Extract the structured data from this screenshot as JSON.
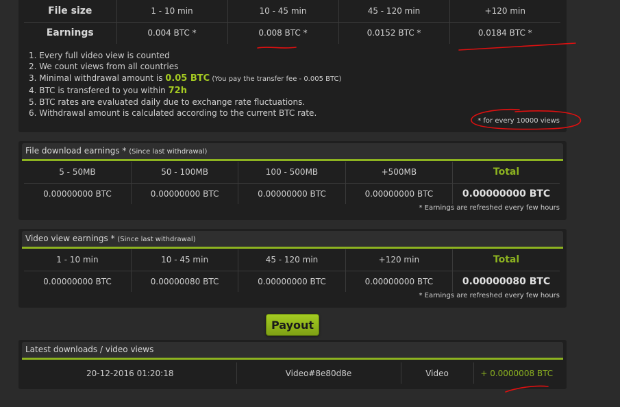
{
  "video_rates": {
    "file_size_label": "File size",
    "earnings_label": "Earnings",
    "durations": [
      "1 - 10 min",
      "10 - 45 min",
      "45 - 120 min",
      "+120 min"
    ],
    "rates": [
      "0.004 BTC *",
      "0.008 BTC *",
      "0.0152 BTC *",
      "0.0184 BTC *"
    ],
    "notes": {
      "n1": "1. Every full video view is counted",
      "n2": "2. We count views from all countries",
      "n3_prefix": "3. Minimal withdrawal amount is ",
      "n3_amount": "0.05 BTC",
      "n3_fee": " (You pay the transfer fee - 0.005 BTC)",
      "n4_prefix": "4. BTC is transfered to you within ",
      "n4_time": "72h",
      "n5": "5. BTC rates are evaluated daily due to exchange rate fluctuations.",
      "n6": "6. Withdrawal amount is calculated according to the current BTC rate."
    },
    "footnote": "* for every 10000 views"
  },
  "file_earnings": {
    "title": "File download earnings * ",
    "since": "(Since last withdrawal)",
    "columns": [
      "5 - 50MB",
      "50 - 100MB",
      "100 - 500MB",
      "+500MB"
    ],
    "total_label": "Total",
    "values": [
      "0.00000000 BTC",
      "0.00000000 BTC",
      "0.00000000 BTC",
      "0.00000000 BTC"
    ],
    "total_value": "0.00000000 BTC",
    "note": "* Earnings are refreshed every few hours"
  },
  "video_earnings": {
    "title": "Video view earnings * ",
    "since": "(Since last withdrawal)",
    "columns": [
      "1 - 10 min",
      "10 - 45 min",
      "45 - 120 min",
      "+120 min"
    ],
    "total_label": "Total",
    "values": [
      "0.00000000 BTC",
      "0.00000080 BTC",
      "0.00000000 BTC",
      "0.00000000 BTC"
    ],
    "total_value": "0.00000080 BTC",
    "note": "* Earnings are refreshed every few hours"
  },
  "payout": {
    "label": "Payout"
  },
  "latest": {
    "title": "Latest downloads / video views",
    "rows": [
      {
        "date": "20-12-2016 01:20:18",
        "name": "Video#8e80d8e",
        "type": "Video",
        "amount": "+ 0.0000008 BTC"
      }
    ]
  },
  "colors": {
    "accent": "#8db320",
    "highlight": "#a6cc22",
    "annotation": "#e01010"
  }
}
